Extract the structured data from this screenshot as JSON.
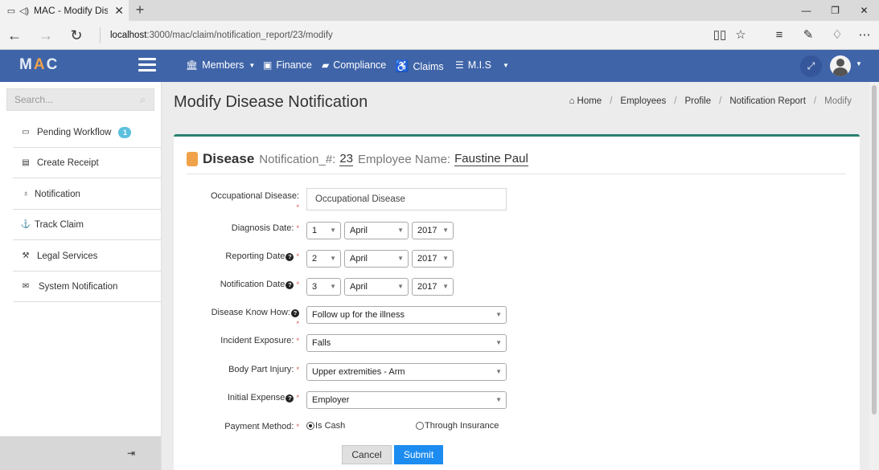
{
  "browser": {
    "tab_title": "MAC - Modify Dise",
    "url_host": "localhost",
    "url_path": ":3000/mac/claim/notification_report/23/modify",
    "icons": [
      "page-icon",
      "speaker-icon",
      "close-tab-icon",
      "new-tab-icon",
      "back-icon",
      "forward-icon",
      "refresh-icon",
      "reading-view-icon",
      "favorite-star-icon",
      "hub-icon",
      "web-note-icon",
      "share-icon",
      "more-icon"
    ]
  },
  "header": {
    "logo_left": "M",
    "logo_accent": "A",
    "logo_right": "C",
    "menu": [
      {
        "label": "Members",
        "icon": "building-icon",
        "has_caret": true
      },
      {
        "label": "Finance",
        "icon": "money-icon",
        "has_caret": false
      },
      {
        "label": "Compliance",
        "icon": "book-icon",
        "has_caret": false
      },
      {
        "label": "Claims",
        "icon": "wheelchair-icon",
        "has_caret": false
      },
      {
        "label": "M.I.S",
        "icon": "list-icon",
        "has_caret": true
      }
    ],
    "colors": {
      "bar": "#3f64a8",
      "accent": "#f0a24a"
    }
  },
  "sidebar": {
    "search_placeholder": "Search...",
    "items": [
      {
        "label": "Pending Workflow",
        "icon": "inbox-icon",
        "badge": "1"
      },
      {
        "label": "Create Receipt",
        "icon": "receipt-icon"
      },
      {
        "label": "Notification",
        "icon": "bell-icon"
      },
      {
        "label": "Track Claim",
        "icon": "track-icon"
      },
      {
        "label": "Legal Services",
        "icon": "gavel-icon"
      },
      {
        "label": "System Notification",
        "icon": "chat-icon"
      }
    ]
  },
  "page": {
    "title": "Modify Disease Notification",
    "breadcrumb": [
      "Home",
      "Employees",
      "Profile",
      "Notification Report",
      "Modify"
    ]
  },
  "form": {
    "heading": "Disease",
    "notification_key": "Notification_#:",
    "notification_value": "23",
    "employee_key": "Employee Name:",
    "employee_value": "Faustine Paul",
    "occupational_disease": {
      "label": "Occupational Disease:",
      "placeholder": "Occupational Disease",
      "value": ""
    },
    "diagnosis_date": {
      "label": "Diagnosis Date:",
      "day": "1",
      "month": "April",
      "year": "2017"
    },
    "reporting_date": {
      "label": "Reporting Date",
      "day": "2",
      "month": "April",
      "year": "2017"
    },
    "notification_date": {
      "label": "Notification Date",
      "day": "3",
      "month": "April",
      "year": "2017"
    },
    "disease_know_how": {
      "label": "Disease Know How:",
      "value": "Follow up for the illness"
    },
    "incident_exposure": {
      "label": "Incident Exposure:",
      "value": "Falls"
    },
    "body_part_injury": {
      "label": "Body Part Injury:",
      "value": "Upper extremities - Arm"
    },
    "initial_expense": {
      "label": "Initial Expense",
      "value": "Employer"
    },
    "payment_method": {
      "label": "Payment Method:",
      "options": [
        "Is Cash",
        "Through Insurance"
      ],
      "selected": "Is Cash"
    },
    "required_mark": "*",
    "help_mark": "?",
    "cancel_label": "Cancel",
    "submit_label": "Submit"
  }
}
